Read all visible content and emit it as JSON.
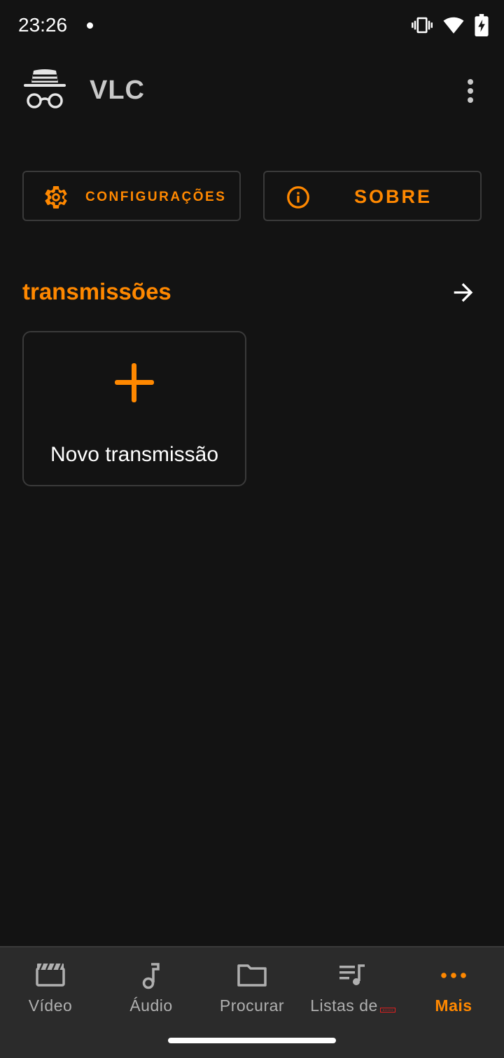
{
  "status_bar": {
    "time": "23:26",
    "icons": [
      "vibrate-icon",
      "wifi-icon",
      "battery-charging-icon"
    ]
  },
  "app_bar": {
    "title": "VLC",
    "logo_icon": "incognito-icon",
    "menu_icon": "more-vert-icon"
  },
  "actions": {
    "settings_label": "CONFIGURAÇÕES",
    "settings_icon": "gear-icon",
    "about_label": "SOBRE",
    "about_icon": "info-icon"
  },
  "streams": {
    "title": "transmissões",
    "arrow_icon": "arrow-right-icon",
    "new_card_label": "Novo transmissão",
    "new_card_icon": "plus-icon"
  },
  "bottom_nav": {
    "items": [
      {
        "label": "Vídeo",
        "icon": "clapperboard-icon"
      },
      {
        "label": "Áudio",
        "icon": "music-note-icon"
      },
      {
        "label": "Procurar",
        "icon": "folder-icon"
      },
      {
        "label": "Listas de",
        "icon": "playlist-icon"
      },
      {
        "label": "Mais",
        "icon": "more-horiz-icon"
      }
    ],
    "active_index": 4
  },
  "colors": {
    "accent": "#ff8800",
    "background": "#131313",
    "nav_background": "#2b2b2b",
    "border": "#3a3a3a"
  }
}
